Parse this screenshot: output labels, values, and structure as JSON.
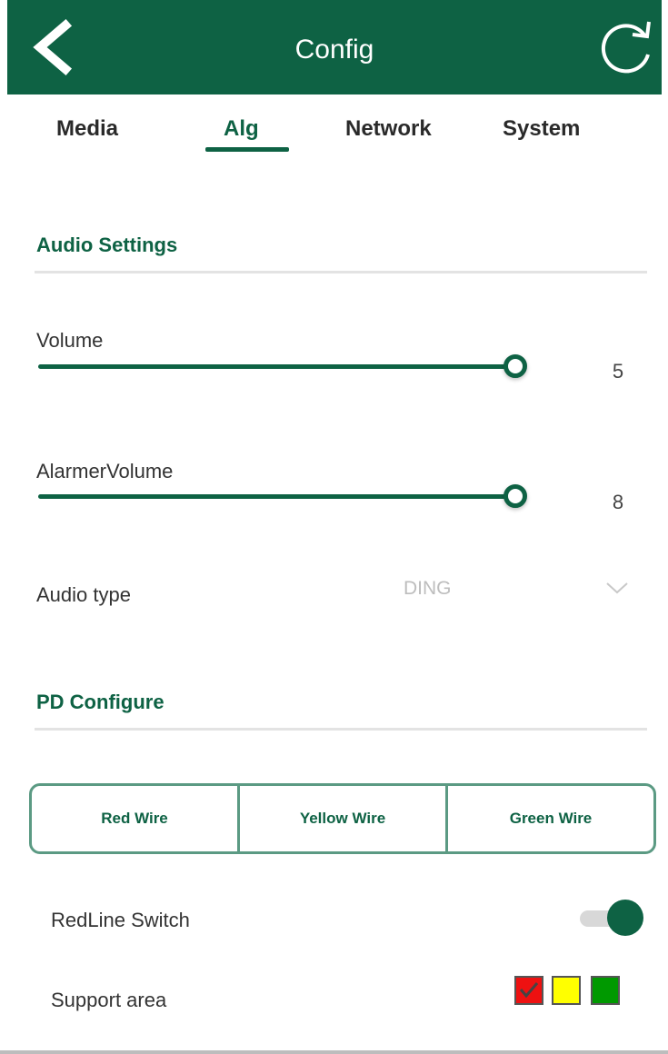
{
  "header": {
    "title": "Config",
    "back_icon": "chevron-left-icon",
    "refresh_icon": "refresh-icon",
    "background_color": "#0e6244"
  },
  "tabs": [
    {
      "label": "Media",
      "active": false
    },
    {
      "label": "Alg",
      "active": true
    },
    {
      "label": "Network",
      "active": false
    },
    {
      "label": "System",
      "active": false
    }
  ],
  "audio_settings": {
    "title": "Audio Settings",
    "volume": {
      "label": "Volume",
      "value": "5"
    },
    "alarmer_volume": {
      "label": "AlarmerVolume",
      "value": "8"
    },
    "audio_type": {
      "label": "Audio type",
      "value": "DING"
    }
  },
  "pd_configure": {
    "title": "PD Configure",
    "wire_buttons": [
      "Red Wire",
      "Yellow Wire",
      "Green Wire"
    ],
    "redline_switch": {
      "label": "RedLine Switch",
      "on": true
    },
    "support_area": {
      "label": "Support area",
      "swatches": [
        {
          "color": "#ee1111",
          "checked": true
        },
        {
          "color": "#ffff00",
          "checked": false
        },
        {
          "color": "#009900",
          "checked": false
        }
      ]
    }
  },
  "colors": {
    "accent": "#0e6244",
    "muted_text": "#bdbdbd",
    "divider": "#e3e3e3"
  }
}
